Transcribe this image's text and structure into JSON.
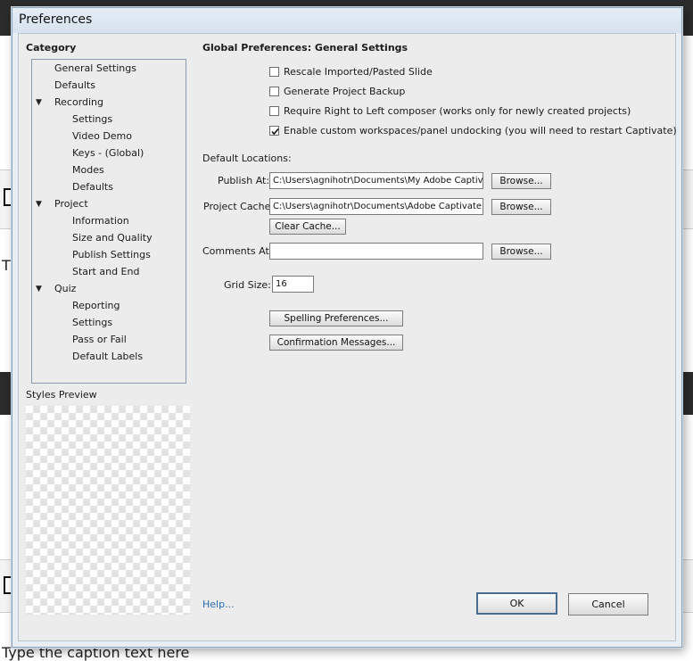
{
  "background": {
    "caption_text": "Type the caption text here",
    "t_fragment": "T"
  },
  "window": {
    "title": "Preferences"
  },
  "category": {
    "label": "Category",
    "items": [
      {
        "label": "General Settings",
        "level": 1,
        "expanded": null
      },
      {
        "label": "Defaults",
        "level": 1,
        "expanded": null
      },
      {
        "label": "Recording",
        "level": 1,
        "expanded": true
      },
      {
        "label": "Settings",
        "level": 2,
        "expanded": null
      },
      {
        "label": "Video Demo",
        "level": 2,
        "expanded": null
      },
      {
        "label": "Keys - (Global)",
        "level": 2,
        "expanded": null
      },
      {
        "label": "Modes",
        "level": 2,
        "expanded": null
      },
      {
        "label": "Defaults",
        "level": 2,
        "expanded": null
      },
      {
        "label": "Project",
        "level": 1,
        "expanded": true
      },
      {
        "label": "Information",
        "level": 2,
        "expanded": null
      },
      {
        "label": "Size and Quality",
        "level": 2,
        "expanded": null
      },
      {
        "label": "Publish Settings",
        "level": 2,
        "expanded": null
      },
      {
        "label": "Start and End",
        "level": 2,
        "expanded": null
      },
      {
        "label": "Quiz",
        "level": 1,
        "expanded": true
      },
      {
        "label": "Reporting",
        "level": 2,
        "expanded": null
      },
      {
        "label": "Settings",
        "level": 2,
        "expanded": null
      },
      {
        "label": "Pass or Fail",
        "level": 2,
        "expanded": null
      },
      {
        "label": "Default Labels",
        "level": 2,
        "expanded": null
      }
    ],
    "selected_index": 0
  },
  "styles_preview": {
    "label": "Styles Preview"
  },
  "settings": {
    "heading": "Global Preferences: General Settings",
    "checkboxes": [
      {
        "label": "Rescale Imported/Pasted Slide",
        "checked": false
      },
      {
        "label": "Generate Project Backup",
        "checked": false
      },
      {
        "label": "Require Right to Left composer (works only for newly created projects)",
        "checked": false
      },
      {
        "label": "Enable custom workspaces/panel undocking (you will need to restart Captivate)",
        "checked": true
      }
    ],
    "default_locations_label": "Default Locations:",
    "publish_at": {
      "label": "Publish At:",
      "value": "C:\\Users\\agnihotr\\Documents\\My Adobe Captivate Projects",
      "browse": "Browse..."
    },
    "project_cache": {
      "label": "Project Cache:",
      "value": "C:\\Users\\agnihotr\\Documents\\Adobe Captivate Cached Projects",
      "browse": "Browse...",
      "clear": "Clear Cache..."
    },
    "comments_at": {
      "label": "Comments At:",
      "value": "",
      "browse": "Browse..."
    },
    "grid_size": {
      "label": "Grid Size:",
      "value": "16"
    },
    "spelling_button": "Spelling Preferences...",
    "confirmation_button": "Confirmation Messages..."
  },
  "footer": {
    "help": "Help...",
    "ok": "OK",
    "cancel": "Cancel"
  }
}
